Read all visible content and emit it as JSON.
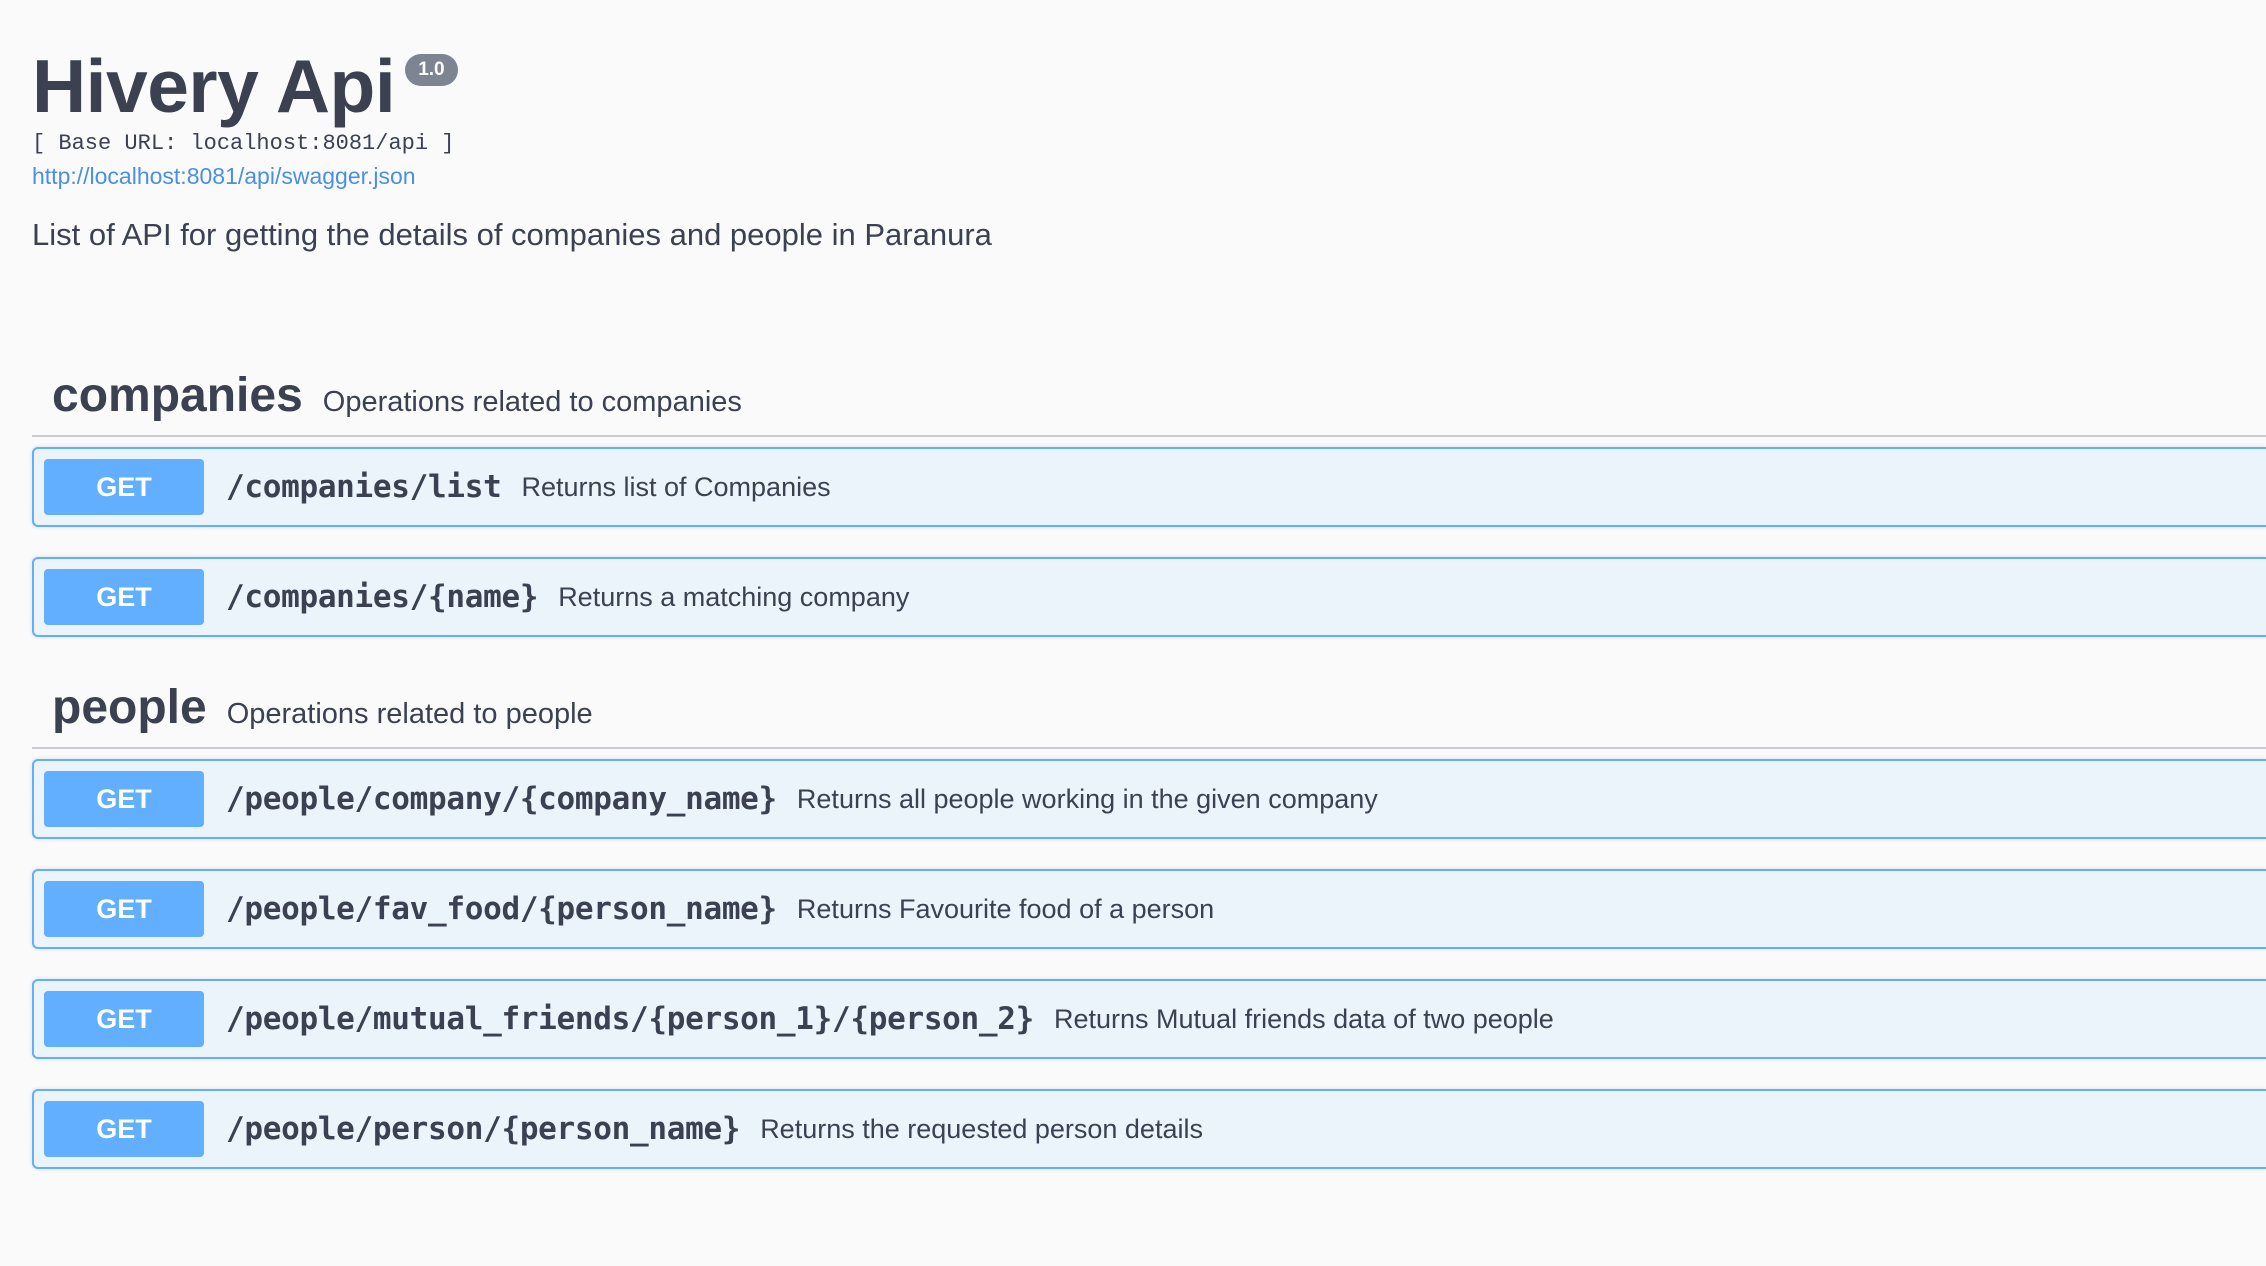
{
  "info": {
    "title": "Hivery Api",
    "version": "1.0",
    "base_url": "[ Base URL: localhost:8081/api ]",
    "spec_link": "http://localhost:8081/api/swagger.json",
    "description": "List of API for getting the details of companies and people in Paranura"
  },
  "sections": {
    "companies": {
      "name": "companies",
      "description": "Operations related to companies",
      "operations": [
        {
          "method": "GET",
          "path": "/companies/list",
          "summary": "Returns list of Companies"
        },
        {
          "method": "GET",
          "path": "/companies/{name}",
          "summary": "Returns a matching company"
        }
      ]
    },
    "people": {
      "name": "people",
      "description": "Operations related to people",
      "operations": [
        {
          "method": "GET",
          "path": "/people/company/{company_name}",
          "summary": "Returns all people working in the given company"
        },
        {
          "method": "GET",
          "path": "/people/fav_food/{person_name}",
          "summary": "Returns Favourite food of a person"
        },
        {
          "method": "GET",
          "path": "/people/mutual_friends/{person_1}/{person_2}",
          "summary": "Returns Mutual friends data of two people"
        },
        {
          "method": "GET",
          "path": "/people/person/{person_name}",
          "summary": "Returns the requested person details"
        }
      ]
    }
  },
  "colors": {
    "get_method": "#61affe",
    "get_background": "#ebf3fb",
    "text": "#3b4151",
    "link": "#4990e2",
    "version_badge": "#7d8492"
  }
}
